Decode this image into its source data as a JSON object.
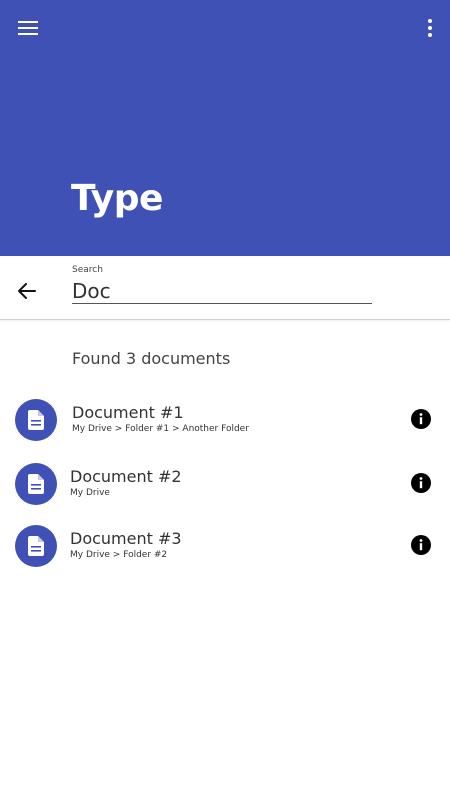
{
  "app": {
    "title": "Type",
    "primary_color": "#3f51b5",
    "menu_icon": "menu-icon",
    "more_icon": "more-vert-icon"
  },
  "search": {
    "label": "Search",
    "value": "Doc",
    "back_icon": "arrow-back-icon"
  },
  "results": {
    "count_text": "Found 3 documents",
    "items": [
      {
        "name": "Document #1",
        "path": "My Drive > Folder #1 > Another Folder",
        "icon": "document-icon",
        "action_icon": "info-icon"
      },
      {
        "name": "Document #2",
        "path": "My Drive",
        "icon": "document-icon",
        "action_icon": "info-icon"
      },
      {
        "name": "Document #3",
        "path": "My Drive > Folder #2",
        "icon": "document-icon",
        "action_icon": "info-icon"
      }
    ]
  }
}
